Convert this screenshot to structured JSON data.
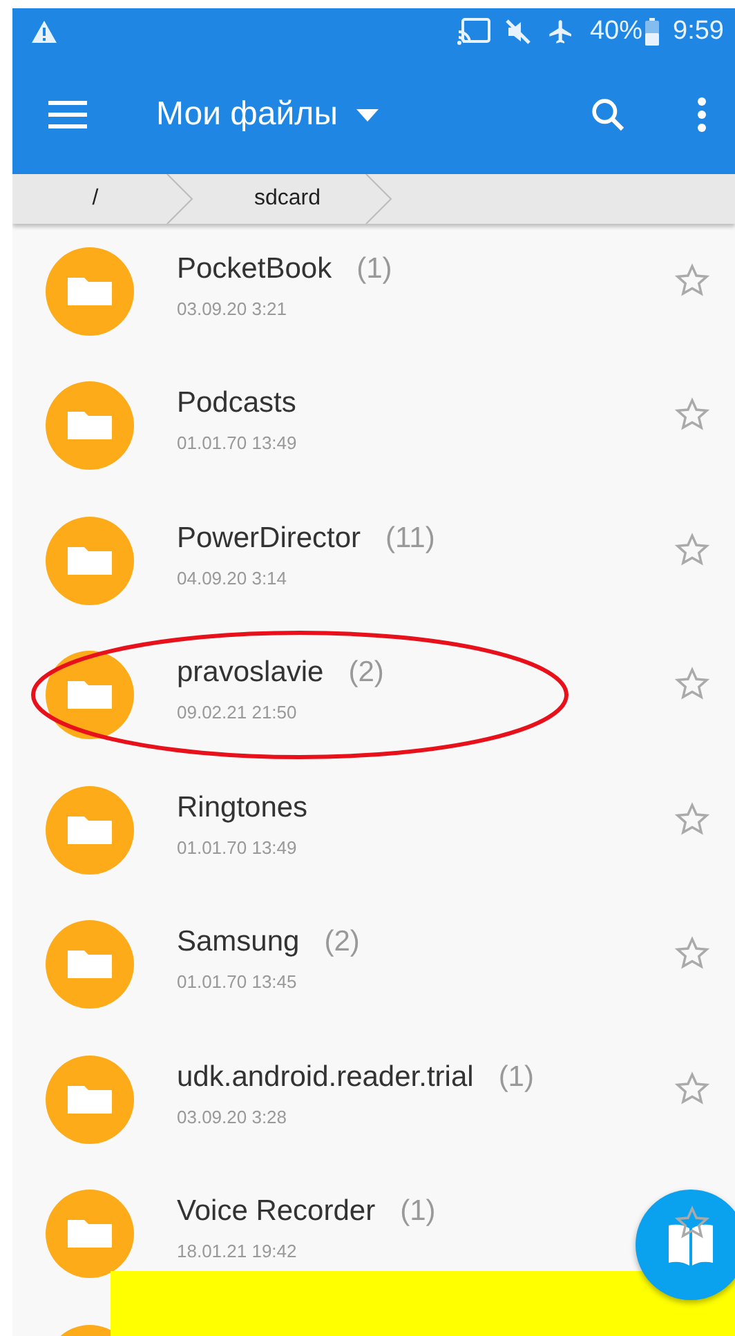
{
  "status_bar": {
    "battery": "40%",
    "time": "9:59"
  },
  "toolbar": {
    "title": "Мои файлы"
  },
  "breadcrumb": [
    "/",
    "sdcard"
  ],
  "folders": [
    {
      "name": "PocketBook",
      "count": "(1)",
      "date": "03.09.20 3:21",
      "starred": false,
      "circled": false
    },
    {
      "name": "Podcasts",
      "date": "01.01.70 13:49",
      "starred": false,
      "circled": false
    },
    {
      "name": "PowerDirector",
      "count": "(11)",
      "date": "04.09.20 3:14",
      "starred": false,
      "circled": false
    },
    {
      "name": "pravoslavie",
      "count": "(2)",
      "date": "09.02.21 21:50",
      "starred": false,
      "circled": true
    },
    {
      "name": "Ringtones",
      "date": "01.01.70 13:49",
      "starred": false,
      "circled": false
    },
    {
      "name": "Samsung",
      "count": "(2)",
      "date": "01.01.70 13:45",
      "starred": false,
      "circled": false
    },
    {
      "name": "udk.android.reader.trial",
      "count": "(1)",
      "date": "03.09.20 3:28",
      "starred": false,
      "circled": false
    },
    {
      "name": "Voice Recorder",
      "count": "(1)",
      "date": "18.01.21 19:42",
      "starred": false,
      "circled": false
    }
  ]
}
